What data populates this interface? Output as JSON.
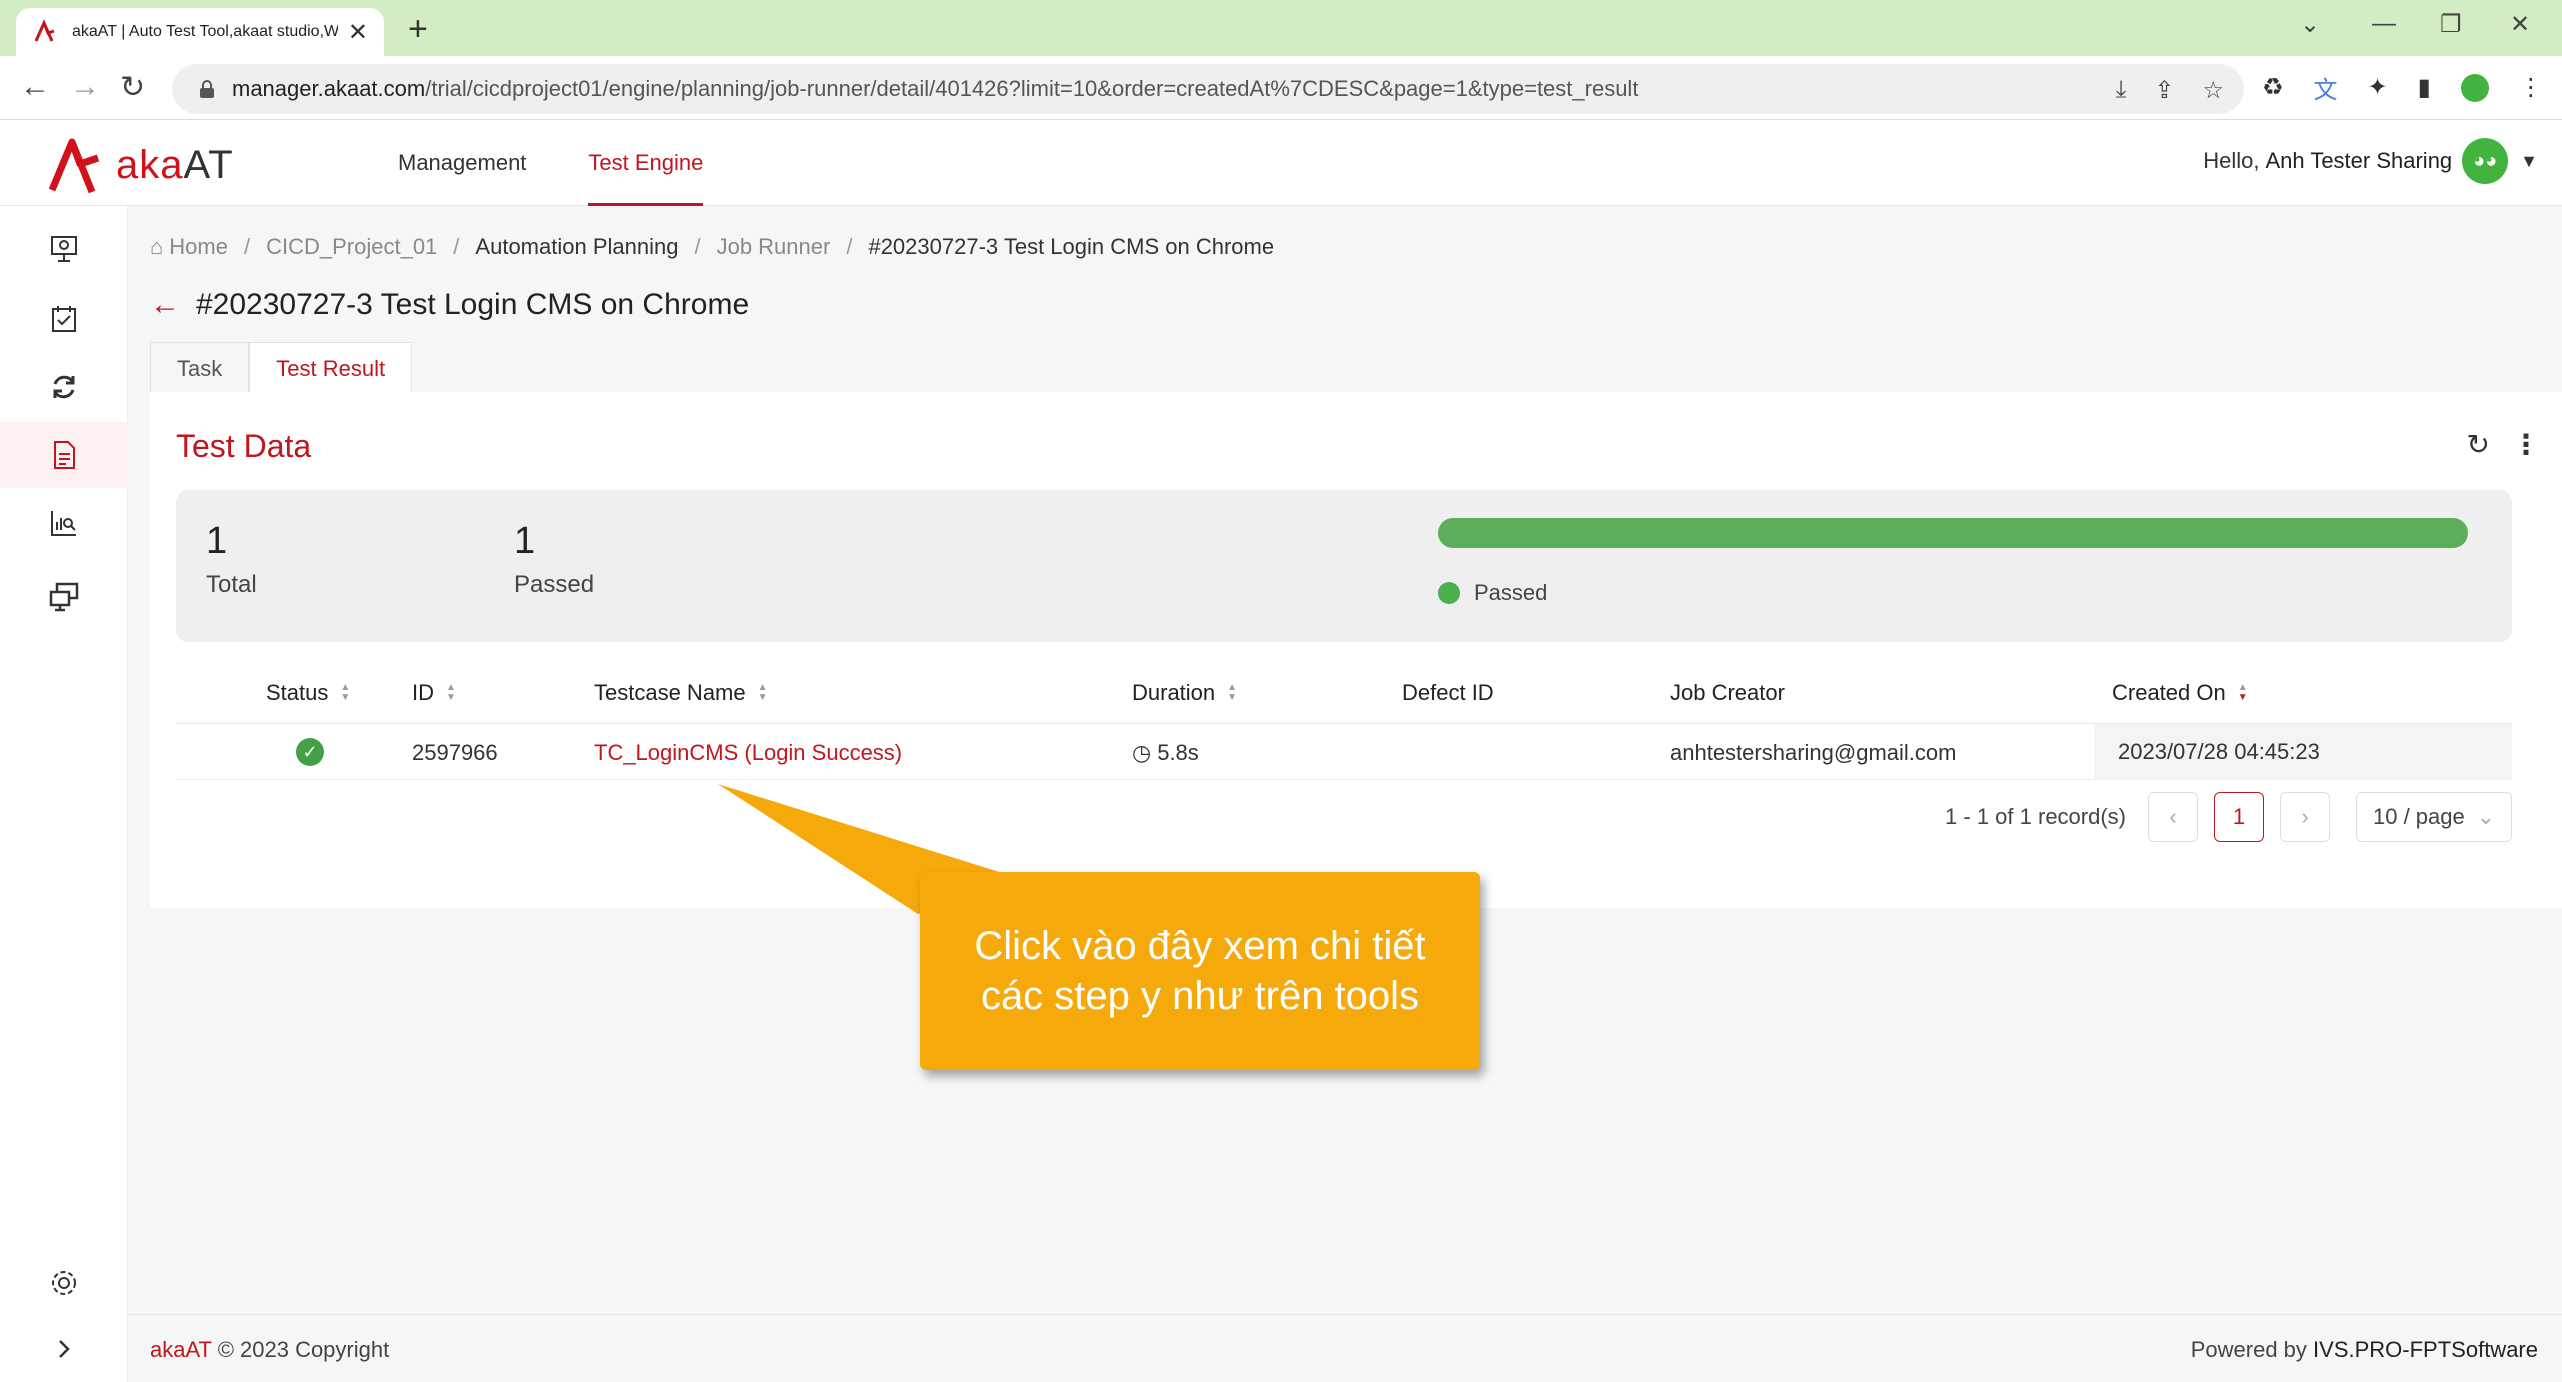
{
  "browser": {
    "tab_title": "akaAT | Auto Test Tool,akaat studio,Web",
    "url_host": "manager.akaat.com",
    "url_path": "/trial/cicdproject01/engine/planning/job-runner/detail/401426?limit=10&order=createdAt%7CDESC&page=1&type=test_result",
    "new_tab": "+",
    "close_tab": "✕"
  },
  "app": {
    "logo_text": "aka",
    "logo_text_2": "AT",
    "nav": [
      {
        "label": "Management"
      },
      {
        "label": "Test Engine"
      }
    ],
    "greeting": "Hello,",
    "user_name": "Anh Tester Sharing"
  },
  "breadcrumb": {
    "home": "Home",
    "project": "CICD_Project_01",
    "planning": "Automation Planning",
    "runner": "Job Runner",
    "current": "#20230727-3 Test Login CMS on Chrome",
    "sep": "/"
  },
  "page": {
    "title": "#20230727-3 Test Login CMS on Chrome",
    "tabs": [
      {
        "label": "Task"
      },
      {
        "label": "Test Result"
      }
    ]
  },
  "test_data": {
    "title": "Test Data",
    "total_value": "1",
    "total_label": "Total",
    "passed_value": "1",
    "passed_label": "Passed",
    "legend_passed": "Passed",
    "pass_fraction": 1.0,
    "pass_color": "#5cae5c"
  },
  "table": {
    "headers": {
      "status": "Status",
      "id": "ID",
      "testcase": "Testcase Name",
      "duration": "Duration",
      "defect": "Defect ID",
      "creator": "Job Creator",
      "created": "Created On"
    },
    "rows": [
      {
        "id": "2597966",
        "testcase": "TC_LoginCMS (Login Success)",
        "duration": "5.8s",
        "defect": "",
        "creator": "anhtestersharing@gmail.com",
        "created": "2023/07/28 04:45:23"
      }
    ]
  },
  "pagination": {
    "info": "1 - 1 of 1 record(s)",
    "current_page": "1",
    "page_size": "10 / page"
  },
  "annotation": {
    "text": "Click vào đây xem chi tiết các step y như trên tools"
  },
  "footer": {
    "brand": "akaAT",
    "copyright": "© 2023 Copyright",
    "powered": "Powered by",
    "company": "IVS.PRO-FPTSoftware"
  },
  "colors": {
    "accent": "#c0161d",
    "success": "#43a047",
    "callout": "#f5a90a"
  }
}
